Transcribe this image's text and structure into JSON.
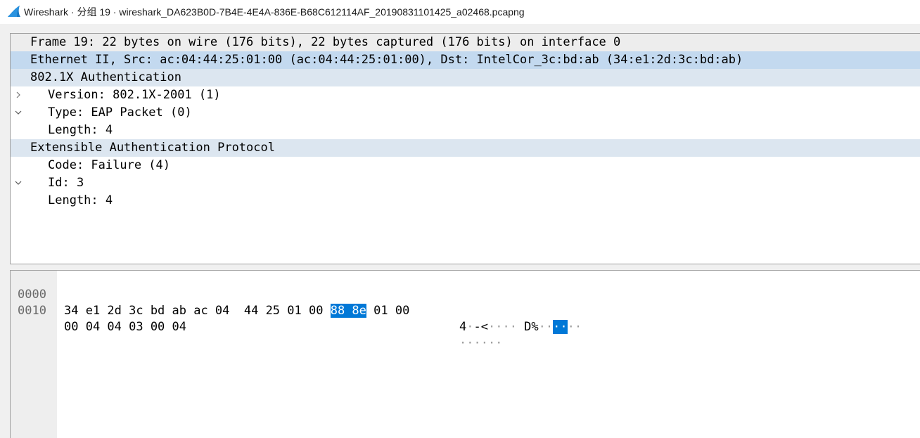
{
  "window": {
    "title": "Wireshark · 分组 19 · wireshark_DA623B0D-7B4E-4E4A-836E-B68C612114AF_20190831101425_a02468.pcapng",
    "icon": "wireshark-fin-icon"
  },
  "tree": [
    {
      "label": "Frame 19: 22 bytes on wire (176 bits), 22 bytes captured (176 bits) on interface 0",
      "expander": "chevron-right",
      "expanded": false
    },
    {
      "label": "Ethernet II, Src: ac:04:44:25:01:00 (ac:04:44:25:01:00), Dst: IntelCor_3c:bd:ab (34:e1:2d:3c:bd:ab)",
      "expander": "chevron-right",
      "expanded": false,
      "selected": true
    },
    {
      "label": "802.1X Authentication",
      "expander": "chevron-down",
      "expanded": true
    },
    {
      "label": "Version: 802.1X-2001 (1)"
    },
    {
      "label": "Type: EAP Packet (0)"
    },
    {
      "label": "Length: 4"
    },
    {
      "label": "Extensible Authentication Protocol",
      "expander": "chevron-down",
      "expanded": true
    },
    {
      "label": "Code: Failure (4)"
    },
    {
      "label": "Id: 3"
    },
    {
      "label": "Length: 4"
    }
  ],
  "bytes": {
    "rows": [
      {
        "offset": "0000",
        "hex_before": "34 e1 2d 3c bd ab ac 04  44 25 01 00 ",
        "hex_highlight": "88 8e",
        "hex_after": " 01 00",
        "ascii_before": "4",
        "ascii_dots_1": "·",
        "ascii_mid1": "-<",
        "ascii_dots_2": "···· ",
        "ascii_mid2": "D%",
        "ascii_dots_3": "··",
        "ascii_highlight": "··",
        "ascii_dots_4": "··"
      },
      {
        "offset": "0010",
        "hex": "00 04 04 03 00 04",
        "ascii_dots": "······"
      }
    ]
  },
  "colors": {
    "selection": "#c3d9ef",
    "byte_highlight": "#0078d7",
    "header_row": "#dce6f0"
  }
}
